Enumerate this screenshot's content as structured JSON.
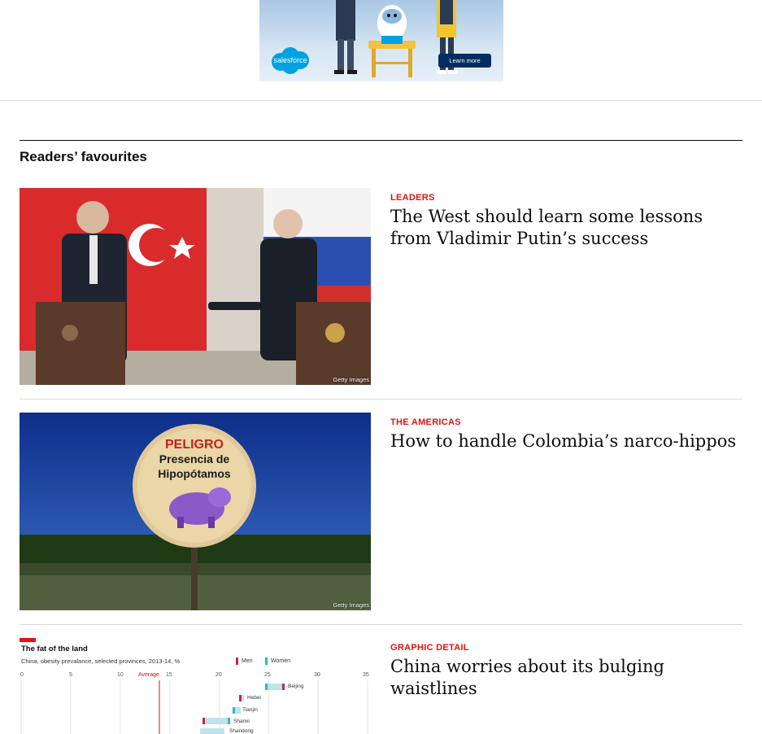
{
  "ad": {
    "brand": "salesforce",
    "cta": "Learn more"
  },
  "section": {
    "title": "Readers’ favourites"
  },
  "articles": [
    {
      "kicker": "LEADERS",
      "headline": "The West should learn some lessons from Vladimir Putin’s success",
      "credit": "Getty Images"
    },
    {
      "kicker": "THE AMERICAS",
      "headline": "How to handle Colombia’s narco-hippos",
      "credit": "Getty Images",
      "sign": {
        "line1": "PELIGRO",
        "line2": "Presencia de",
        "line3": "Hipopótamos"
      }
    },
    {
      "kicker": "GRAPHIC DETAIL",
      "headline": "China worries about its bulging waistlines",
      "chart": {
        "title": "The fat of the land",
        "subtitle": "China, obesity prevalance, selected provinces, 2013-14, %",
        "legend": [
          "Men",
          "Women"
        ],
        "ticks": [
          "0",
          "5",
          "10",
          "15",
          "20",
          "25",
          "30",
          "35"
        ],
        "average_label": "Average",
        "provinces": [
          "Beijing",
          "Hebei",
          "Tianjin",
          "Shanxi",
          "Shandong"
        ]
      }
    }
  ],
  "colors": {
    "kicker": "#e3120b",
    "link_button": "#032d60",
    "salesforce_blue": "#00a1e0"
  }
}
